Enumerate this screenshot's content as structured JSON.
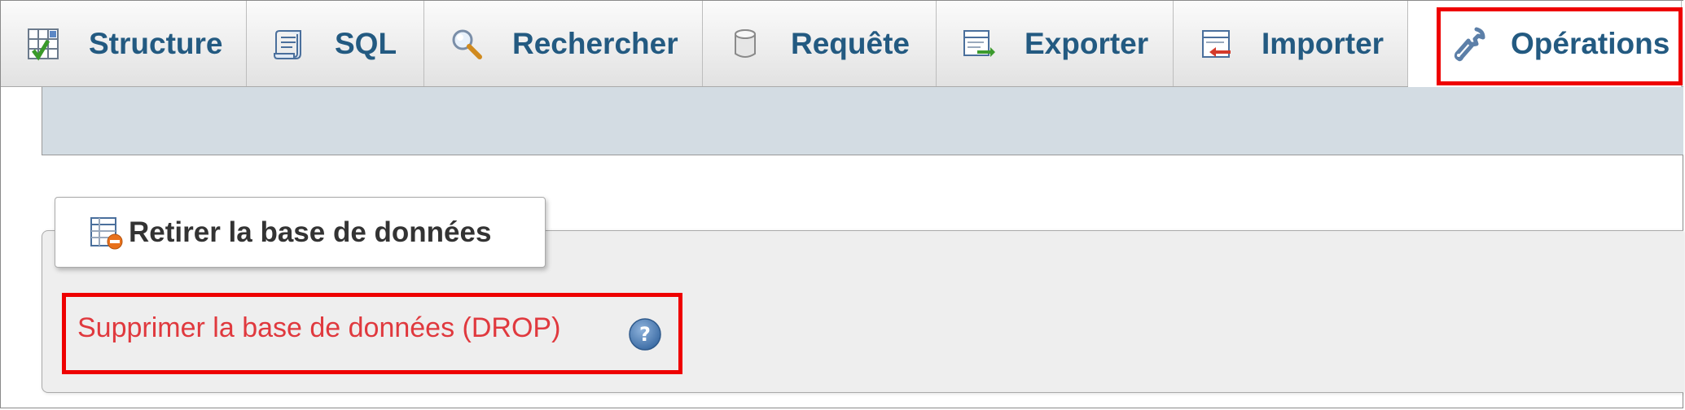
{
  "tabs": [
    {
      "label": "Structure",
      "icon": "structure-icon",
      "active": false
    },
    {
      "label": "SQL",
      "icon": "sql-scroll-icon",
      "active": false
    },
    {
      "label": "Rechercher",
      "icon": "search-magnifier-icon",
      "active": false
    },
    {
      "label": "Requête",
      "icon": "database-cylinder-icon",
      "active": false
    },
    {
      "label": "Exporter",
      "icon": "export-icon",
      "active": false
    },
    {
      "label": "Importer",
      "icon": "import-icon",
      "active": false
    },
    {
      "label": "Opérations",
      "icon": "wrench-icon",
      "active": true
    }
  ],
  "fieldset": {
    "legend": "Retirer la base de données",
    "legend_icon": "drop-database-icon",
    "drop_link": "Supprimer la base de données (DROP)",
    "help_icon": "help-icon"
  },
  "colors": {
    "tab_text": "#235a81",
    "drop_link": "#e0393e",
    "highlight": "#ee0000",
    "subbar": "#d3dce3"
  }
}
